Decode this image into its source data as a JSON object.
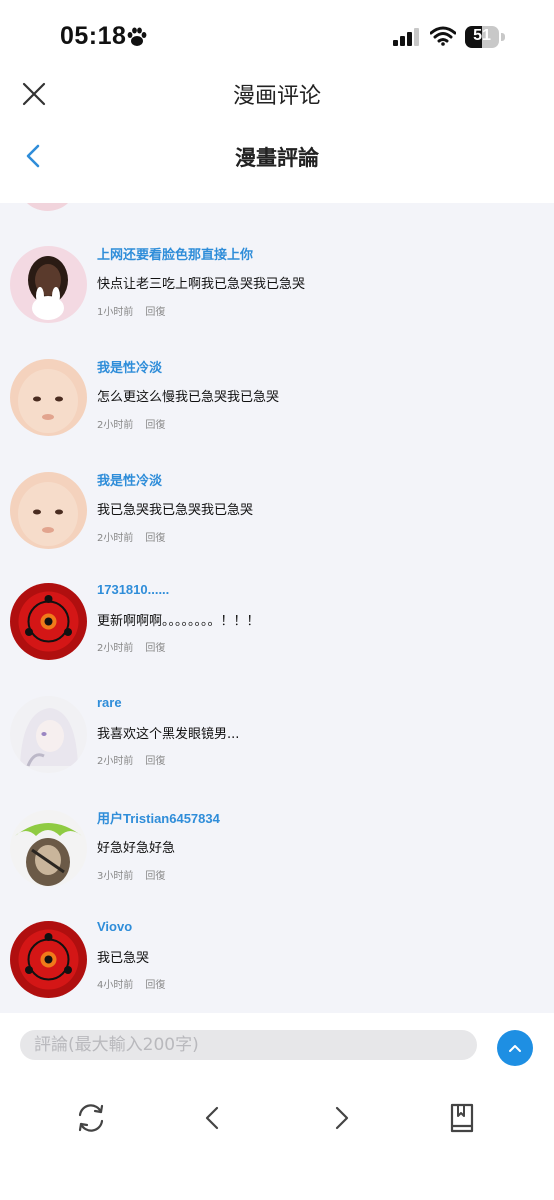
{
  "status_bar": {
    "time": "05:18",
    "battery": "51",
    "battery_level": 0.51
  },
  "header": {
    "title": "漫画评论",
    "subtitle": "漫畫評論"
  },
  "comments": [
    {
      "username": "上网还要看脸色那直接上你",
      "text": "快点让老三吃上啊我已急哭我已急哭",
      "time": "1小时前",
      "reply": "回復",
      "avatar": "girl-with-bunny"
    },
    {
      "username": "我是性冷淡",
      "text": "怎么更这么慢我已急哭我已急哭",
      "time": "2小时前",
      "reply": "回復",
      "avatar": "baby-face"
    },
    {
      "username": "我是性冷淡",
      "text": "我已急哭我已急哭我已急哭",
      "time": "2小时前",
      "reply": "回復",
      "avatar": "baby-face"
    },
    {
      "username": "1731810......",
      "text": "更新啊啊啊。。。。。。。。！！！",
      "time": "2小时前",
      "reply": "回復",
      "avatar": "sharingan"
    },
    {
      "username": "rare",
      "text": "我喜欢这个黑发眼镜男...",
      "time": "2小时前",
      "reply": "回復",
      "avatar": "white-hair-anime"
    },
    {
      "username": "用户Tristian6457834",
      "text": "好急好急好急",
      "time": "3小时前",
      "reply": "回復",
      "avatar": "green-hair-character"
    },
    {
      "username": "Viovo",
      "text": "我已急哭",
      "time": "4小时前",
      "reply": "回復",
      "avatar": "sharingan"
    }
  ],
  "comment_input": {
    "placeholder": "評論(最大輸入200字)"
  },
  "colors": {
    "accent": "#1e8fe3",
    "username": "#2f8dd9",
    "list_bg": "#f3f4f9"
  },
  "icons": [
    "close-icon",
    "back-icon",
    "send-up-icon",
    "refresh-icon",
    "prev-icon",
    "next-icon",
    "bookmark-icon"
  ]
}
